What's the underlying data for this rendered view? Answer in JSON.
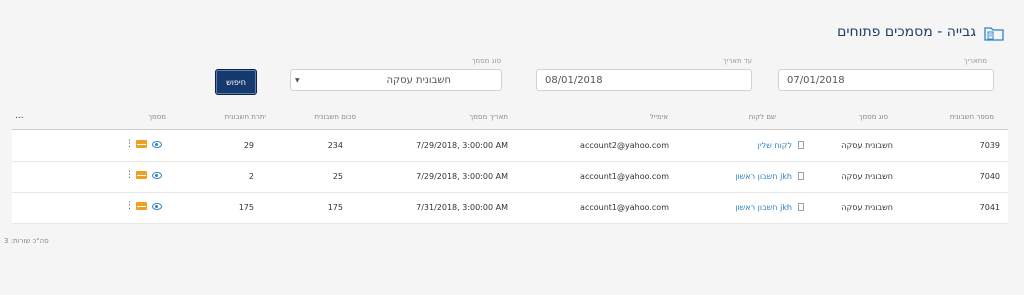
{
  "header": {
    "title": "גבייה - מסמכים פתוחים",
    "icon": "folder-document-icon"
  },
  "filters": {
    "from_date_label": "מתאריך",
    "from_date_value": "07/01/2018",
    "to_date_label": "עד תאריך",
    "to_date_value": "08/01/2018",
    "doc_type_label": "סוג מסמך",
    "doc_type_value": "חשבונית עסקה",
    "search_label": "חיפוש"
  },
  "table": {
    "columns": [
      "מספר חשבונית",
      "סוג מסמך",
      "שם לקוח",
      "אימייל",
      "תאריך מסמך",
      "סכום חשבונית",
      "יתרת חשבונית",
      "מסמך"
    ],
    "more_label": "...",
    "rows": [
      {
        "number": "7039",
        "type": "חשבונית עסקה",
        "customer": "לקוח שלין",
        "email": "account2@yahoo.com",
        "date": "7/29/2018, 3:00:00 AM",
        "amount": "234",
        "balance": "29"
      },
      {
        "number": "7040",
        "type": "חשבונית עסקה",
        "customer": "חשבון ראשון jkh",
        "email": "account1@yahoo.com",
        "date": "7/29/2018, 3:00:00 AM",
        "amount": "25",
        "balance": "2"
      },
      {
        "number": "7041",
        "type": "חשבונית עסקה",
        "customer": "חשבון ראשון jkh",
        "email": "account1@yahoo.com",
        "date": "7/31/2018, 3:00:00 AM",
        "amount": "175",
        "balance": "175"
      }
    ]
  },
  "footer": {
    "total_rows": "סה\"כ שורות: 3"
  },
  "colors": {
    "accent": "#2a84c8",
    "button": "#163a6e",
    "mail": "#f0a020",
    "title": "#1c3f66"
  }
}
